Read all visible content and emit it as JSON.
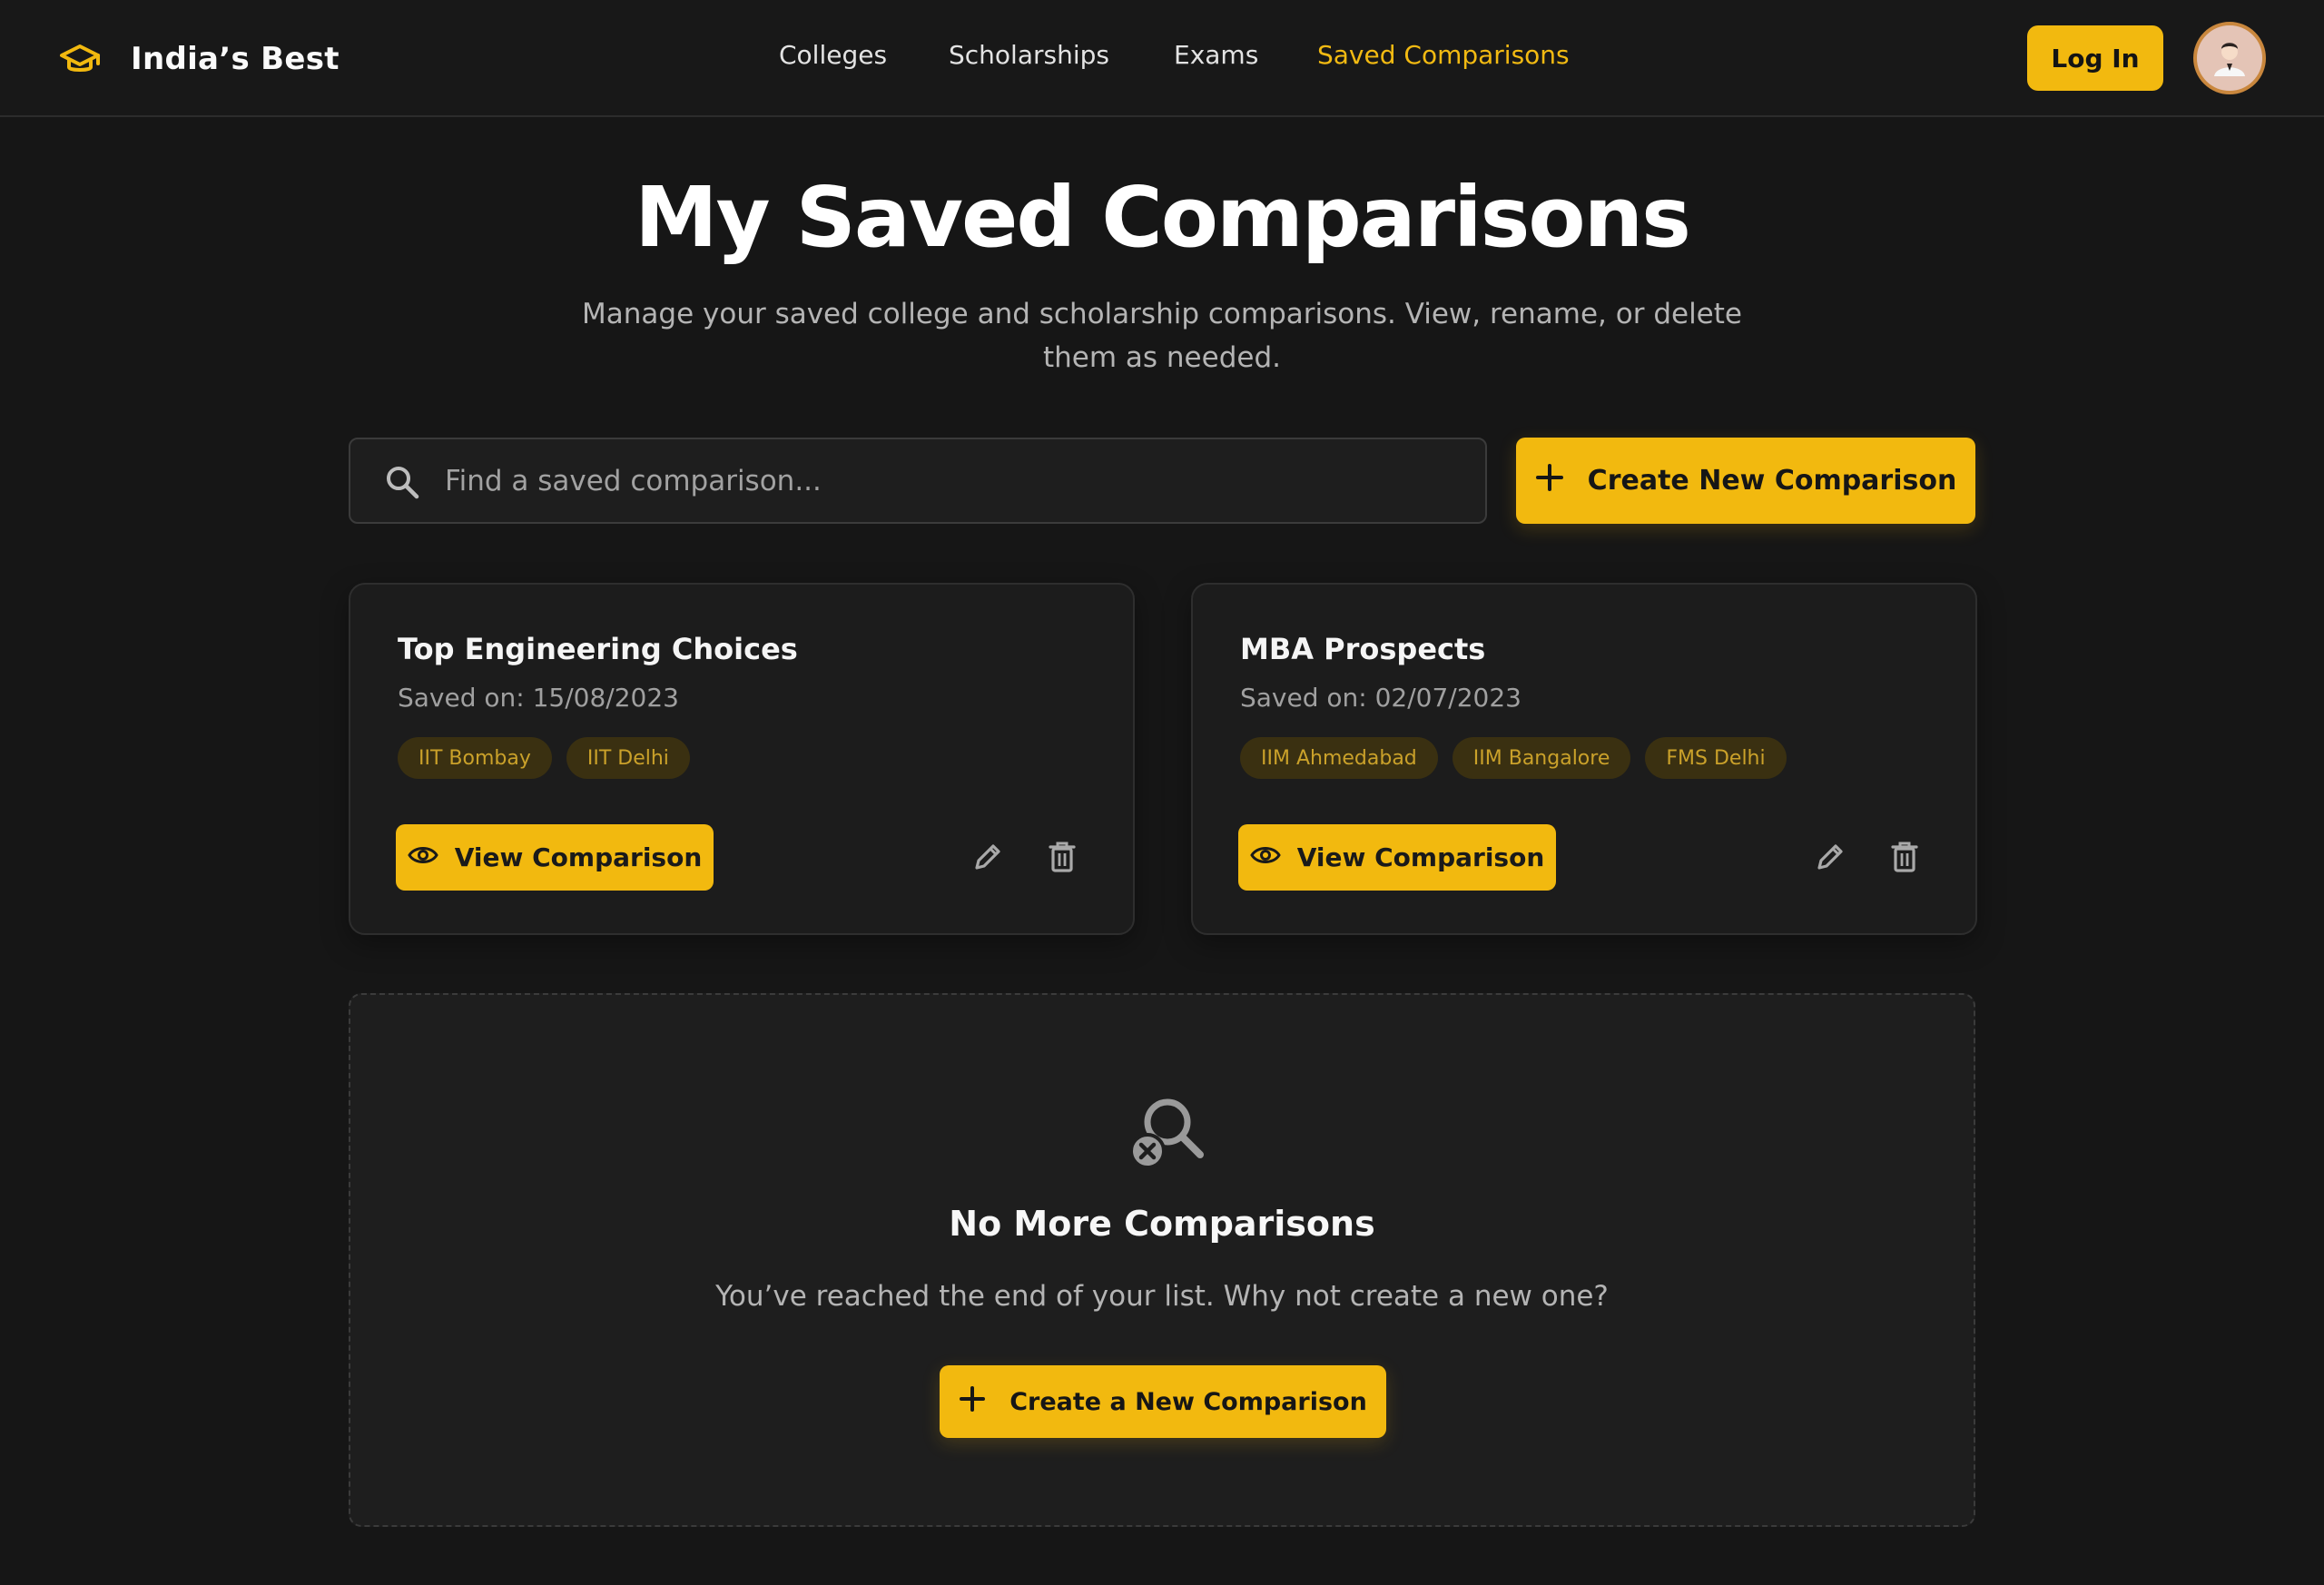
{
  "header": {
    "brand": {
      "name": "India’s Best",
      "icon": "graduation-cap-icon"
    },
    "nav": [
      {
        "label": "Colleges",
        "active": false
      },
      {
        "label": "Scholarships",
        "active": false
      },
      {
        "label": "Exams",
        "active": false
      },
      {
        "label": "Saved Comparisons",
        "active": true
      }
    ],
    "login_label": "Log In",
    "avatar_icon": "user-avatar-icon"
  },
  "hero": {
    "title": "My Saved Comparisons",
    "subtitle": "Manage your saved college and scholarship comparisons. View, rename, or delete them as needed."
  },
  "search": {
    "placeholder": "Find a saved comparison...",
    "value": "",
    "icon": "search-icon"
  },
  "create_button": {
    "label": "Create New Comparison",
    "icon": "plus-icon"
  },
  "comparisons": [
    {
      "title": "Top Engineering Choices",
      "saved_on": "Saved on: 15/08/2023",
      "tags": [
        "IIT Bombay",
        "IIT Delhi"
      ],
      "view_label": "View Comparison"
    },
    {
      "title": "MBA Prospects",
      "saved_on": "Saved on: 02/07/2023",
      "tags": [
        "IIM Ahmedabad",
        "IIM Bangalore",
        "FMS Delhi"
      ],
      "view_label": "View Comparison"
    }
  ],
  "empty_state": {
    "icon": "search-off-icon",
    "title": "No More Comparisons",
    "text": "You’ve reached the end of your list. Why not create a new one?",
    "button_label": "Create a New Comparison"
  },
  "colors": {
    "accent": "#f2b90f",
    "background": "#161616",
    "card": "#1c1c1c",
    "tag_bg": "#3a3011",
    "tag_text": "#caa12a"
  }
}
